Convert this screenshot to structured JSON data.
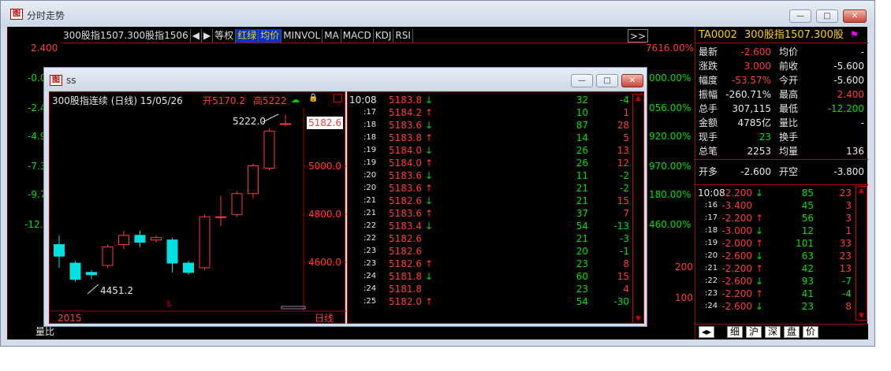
{
  "window": {
    "title": "分时走势",
    "btn_min": "—",
    "btn_max": "□",
    "btn_close": "✕"
  },
  "toolbar": {
    "items": [
      "300股指1507.300股指1506",
      "◀",
      "▶",
      "等权",
      "红绿",
      "均价",
      "MINVOL",
      "MA",
      "MACD",
      "KDJ",
      "RSI"
    ],
    "scroll": ">>"
  },
  "left_axis": [
    "2.400",
    "-0.0",
    "-2.4",
    "-4.9",
    "-7.3",
    "-9.7",
    "-12.2"
  ],
  "right_axis": [
    "7616.00%",
    "000.00%",
    "056.00%",
    "920.00%",
    "970.00%",
    "180.00%",
    "460.00%"
  ],
  "right_axis_extra": [
    "200",
    "100"
  ],
  "footer_label": "量比",
  "quote": {
    "code": "TA0002",
    "name": "300股指1507.300股",
    "rows": [
      {
        "l1": "最新",
        "v1": "-2.600",
        "l2": "均价",
        "v2": "-",
        "c1": "red",
        "c2": "wht"
      },
      {
        "l1": "涨跌",
        "v1": "3.000",
        "l2": "前收",
        "v2": "-5.600",
        "c1": "red",
        "c2": "wht"
      },
      {
        "l1": "幅度",
        "v1": "-53.57%",
        "l2": "今开",
        "v2": "-5.600",
        "c1": "red",
        "c2": "wht"
      },
      {
        "l1": "振幅",
        "v1": "-260.71%",
        "l2": "最高",
        "v2": "2.400",
        "c1": "wht",
        "c2": "red"
      },
      {
        "l1": "总手",
        "v1": "307,115",
        "l2": "最低",
        "v2": "-12.200",
        "c1": "wht",
        "c2": "grn"
      },
      {
        "l1": "金额",
        "v1": "4785亿",
        "l2": "量比",
        "v2": "-",
        "c1": "wht",
        "c2": "wht"
      },
      {
        "l1": "现手",
        "v1": "23",
        "l2": "换手",
        "v2": "",
        "c1": "grn",
        "c2": "wht"
      },
      {
        "l1": "总笔",
        "v1": "2253",
        "l2": "均量",
        "v2": "136",
        "c1": "wht",
        "c2": "wht"
      },
      {
        "l1": "开多",
        "v1": "-2.600",
        "l2": "开空",
        "v2": "-3.800",
        "c1": "wht",
        "c2": "wht"
      }
    ]
  },
  "ticks": [
    {
      "t": "10:08",
      "p": "-2.200",
      "a": "↓",
      "v": "85",
      "n": "23",
      "ac": "grn",
      "nc": "red"
    },
    {
      "t": ":16",
      "p": "-3.400",
      "a": "",
      "v": "45",
      "n": "3",
      "ac": "wht",
      "nc": "red"
    },
    {
      "t": ":17",
      "p": "-2.200",
      "a": "↑",
      "v": "56",
      "n": "3",
      "ac": "red",
      "nc": "red"
    },
    {
      "t": ":18",
      "p": "-3.000",
      "a": "↓",
      "v": "12",
      "n": "1",
      "ac": "grn",
      "nc": "red"
    },
    {
      "t": ":19",
      "p": "-2.000",
      "a": "↑",
      "v": "101",
      "n": "33",
      "ac": "red",
      "nc": "red"
    },
    {
      "t": ":20",
      "p": "-2.600",
      "a": "↓",
      "v": "63",
      "n": "23",
      "ac": "grn",
      "nc": "red"
    },
    {
      "t": ":21",
      "p": "-2.200",
      "a": "↑",
      "v": "42",
      "n": "13",
      "ac": "red",
      "nc": "red"
    },
    {
      "t": ":22",
      "p": "-2.600",
      "a": "↓",
      "v": "93",
      "n": "-7",
      "ac": "grn",
      "nc": "grn"
    },
    {
      "t": ":23",
      "p": "-2.200",
      "a": "↑",
      "v": "41",
      "n": "-4",
      "ac": "red",
      "nc": "grn"
    },
    {
      "t": ":24",
      "p": "-2.600",
      "a": "↓",
      "v": "23",
      "n": "8",
      "ac": "grn",
      "nc": "red"
    }
  ],
  "bottom_tabs": [
    "细",
    "沪",
    "深",
    "盘",
    "价"
  ],
  "sub": {
    "title": "ss",
    "header": {
      "name": "300股指连续 (日线) 15/05/26",
      "open": "开5170.2",
      "high": "高5222"
    },
    "price_axis": [
      "5000.0",
      "4800.0",
      "4600.0"
    ],
    "current_price": "5182.6",
    "annot_high": "5222.0",
    "annot_low": "4451.2",
    "year": "2015",
    "period": "日线",
    "trades": [
      {
        "t": "10:08",
        "p": "5183.8",
        "a": "↓",
        "v": "32",
        "n": "-4"
      },
      {
        "t": ":17",
        "p": "5184.2",
        "a": "↑",
        "v": "10",
        "n": "1"
      },
      {
        "t": ":18",
        "p": "5183.6",
        "a": "↓",
        "v": "87",
        "n": "28"
      },
      {
        "t": ":18",
        "p": "5183.8",
        "a": "↑",
        "v": "14",
        "n": "5"
      },
      {
        "t": ":19",
        "p": "5184.0",
        "a": "↓",
        "v": "26",
        "n": "13"
      },
      {
        "t": ":19",
        "p": "5184.0",
        "a": "↑",
        "v": "26",
        "n": "12"
      },
      {
        "t": ":20",
        "p": "5183.6",
        "a": "↓",
        "v": "11",
        "n": "-2"
      },
      {
        "t": ":20",
        "p": "5183.6",
        "a": "↑",
        "v": "21",
        "n": "-2"
      },
      {
        "t": ":21",
        "p": "5182.6",
        "a": "↓",
        "v": "21",
        "n": "15"
      },
      {
        "t": ":21",
        "p": "5183.6",
        "a": "↑",
        "v": "37",
        "n": "7"
      },
      {
        "t": ":22",
        "p": "5183.4",
        "a": "↓",
        "v": "54",
        "n": "-13"
      },
      {
        "t": ":22",
        "p": "5182.6",
        "a": "",
        "v": "21",
        "n": "-3"
      },
      {
        "t": ":23",
        "p": "5182.6",
        "a": "",
        "v": "20",
        "n": "-1"
      },
      {
        "t": ":23",
        "p": "5182.6",
        "a": "↑",
        "v": "23",
        "n": "8"
      },
      {
        "t": ":24",
        "p": "5181.8",
        "a": "↓",
        "v": "60",
        "n": "15"
      },
      {
        "t": ":24",
        "p": "5181.8",
        "a": "",
        "v": "23",
        "n": "4"
      },
      {
        "t": ":25",
        "p": "5182.0",
        "a": "↑",
        "v": "54",
        "n": "-30"
      }
    ]
  },
  "chart_data": {
    "type": "candlestick",
    "ylim": [
      4400,
      5250
    ],
    "candles": [
      {
        "o": 4660,
        "c": 4610,
        "h": 4700,
        "l": 4560
      },
      {
        "o": 4580,
        "c": 4510,
        "h": 4590,
        "l": 4500
      },
      {
        "o": 4540,
        "c": 4530,
        "h": 4550,
        "l": 4510
      },
      {
        "o": 4570,
        "c": 4650,
        "h": 4660,
        "l": 4560
      },
      {
        "o": 4660,
        "c": 4700,
        "h": 4720,
        "l": 4640
      },
      {
        "o": 4700,
        "c": 4670,
        "h": 4720,
        "l": 4650
      },
      {
        "o": 4680,
        "c": 4690,
        "h": 4700,
        "l": 4670
      },
      {
        "o": 4680,
        "c": 4580,
        "h": 4690,
        "l": 4540
      },
      {
        "o": 4580,
        "c": 4540,
        "h": 4590,
        "l": 4530
      },
      {
        "o": 4560,
        "c": 4780,
        "h": 4790,
        "l": 4550
      },
      {
        "o": 4780,
        "c": 4780,
        "h": 4870,
        "l": 4740
      },
      {
        "o": 4790,
        "c": 4880,
        "h": 4890,
        "l": 4780
      },
      {
        "o": 4880,
        "c": 5000,
        "h": 5010,
        "l": 4860
      },
      {
        "o": 4990,
        "c": 5150,
        "h": 5160,
        "l": 4980
      },
      {
        "o": 5180,
        "c": 5182,
        "h": 5222,
        "l": 5170
      }
    ]
  }
}
